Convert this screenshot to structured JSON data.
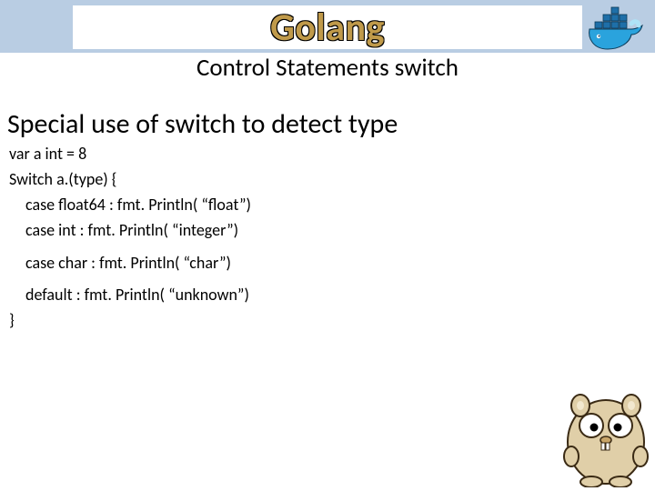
{
  "header": {
    "title": "Golang",
    "subtitle": "Control Statements switch"
  },
  "section": {
    "heading": "Special use of switch to detect type"
  },
  "code": {
    "line1": "var a int = 8",
    "line2": "Switch a.(type) {",
    "line3": "case float64 : fmt. Println( “float”)",
    "line4": "case int : fmt. Println( “integer”)",
    "line5": "case char : fmt. Println( “char”)",
    "line6": "default : fmt. Println( “unknown”)",
    "line7": "}"
  },
  "icons": {
    "docker": "docker-whale",
    "gopher": "go-gopher"
  },
  "colors": {
    "band": "#b9cde3",
    "title_fill": "#c09a4a"
  }
}
